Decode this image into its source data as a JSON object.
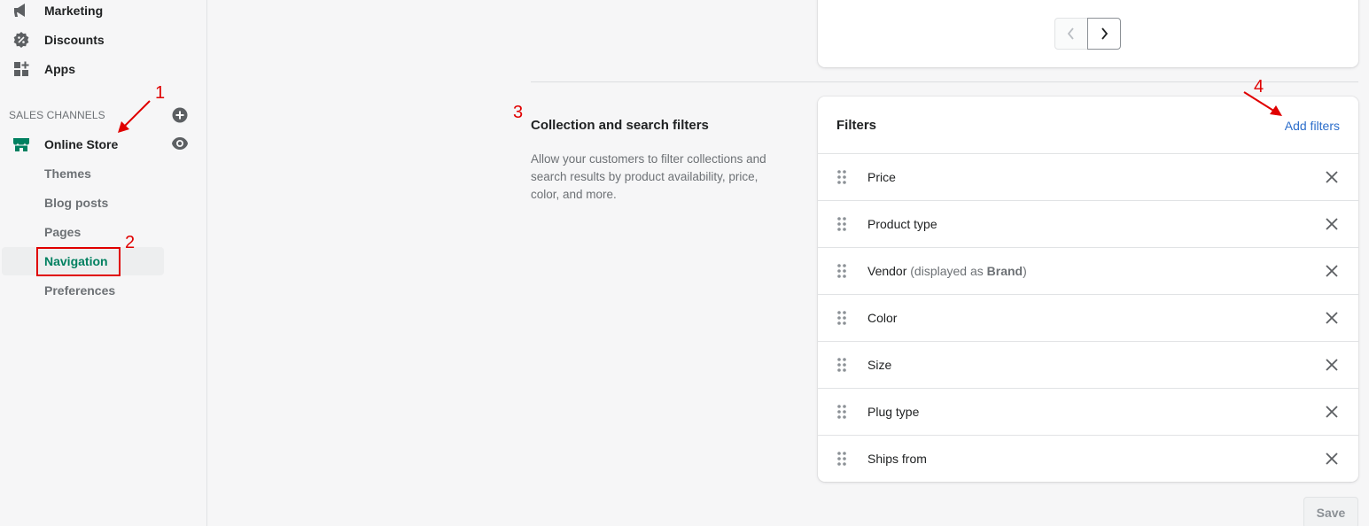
{
  "sidebar": {
    "top_items": [
      {
        "label": "Marketing",
        "icon": "megaphone-icon"
      },
      {
        "label": "Discounts",
        "icon": "discount-icon"
      },
      {
        "label": "Apps",
        "icon": "apps-icon"
      }
    ],
    "section_heading": "SALES CHANNELS",
    "channel": {
      "label": "Online Store",
      "icon": "store-icon"
    },
    "sub_items": [
      "Themes",
      "Blog posts",
      "Pages",
      "Navigation",
      "Preferences"
    ],
    "active_sub_item": "Navigation"
  },
  "filters_section": {
    "title": "Collection and search filters",
    "description": "Allow your customers to filter collections and search results by product availability, price, color, and more."
  },
  "filters_card": {
    "title": "Filters",
    "add_label": "Add filters",
    "rows": [
      {
        "label": "Price"
      },
      {
        "label": "Product type"
      },
      {
        "label": "Vendor",
        "note_prefix": "(displayed as ",
        "note_bold": "Brand",
        "note_suffix": ")"
      },
      {
        "label": "Color"
      },
      {
        "label": "Size"
      },
      {
        "label": "Plug type"
      },
      {
        "label": "Ships from"
      }
    ]
  },
  "save_label": "Save",
  "annotations": [
    "1",
    "2",
    "3",
    "4"
  ],
  "colors": {
    "accent_green": "#008060",
    "link_blue": "#2c6ecb",
    "annotation_red": "#e00000"
  }
}
